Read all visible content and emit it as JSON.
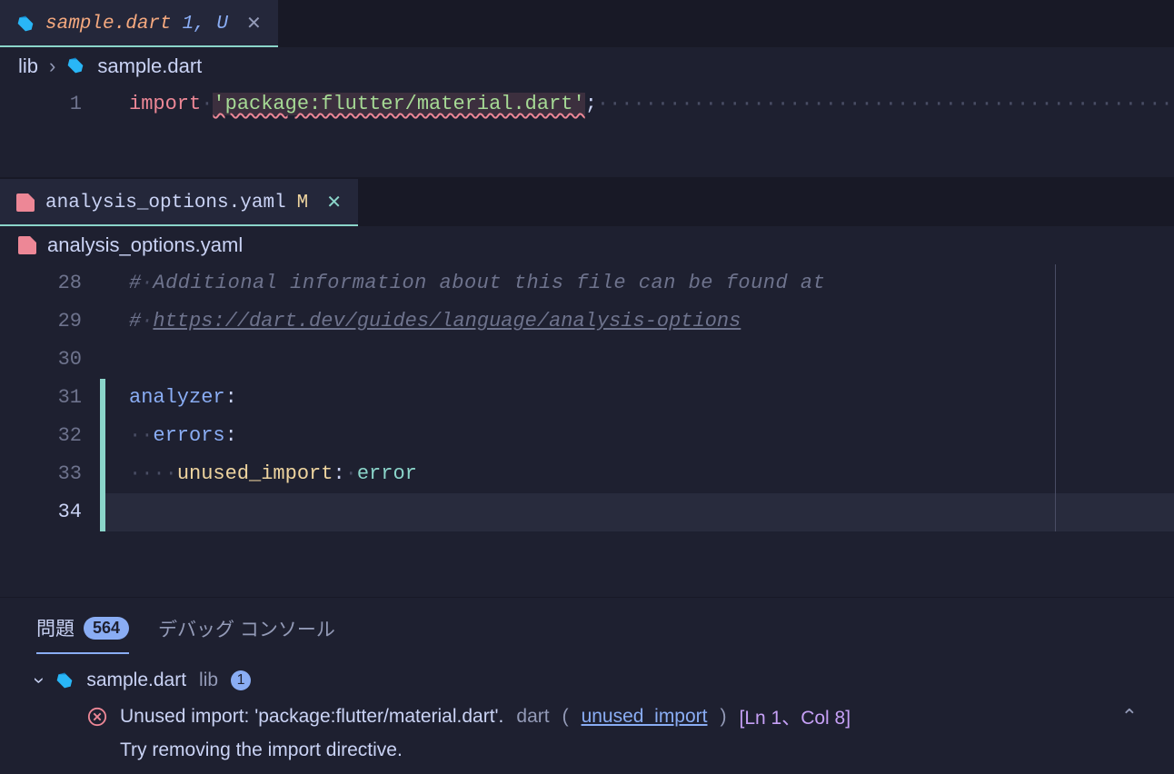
{
  "top": {
    "tab": {
      "filename": "sample.dart",
      "status": "1, U"
    },
    "breadcrumb": {
      "folder": "lib",
      "file": "sample.dart"
    },
    "line": {
      "num": "1",
      "importKw": "import",
      "str": "'package:flutter/material.dart'",
      "semi": ";"
    }
  },
  "mid": {
    "tab": {
      "filename": "analysis_options.yaml",
      "status": "M"
    },
    "breadcrumb": {
      "file": "analysis_options.yaml"
    },
    "lines": {
      "n28": "28",
      "c28a": "#",
      "c28b": "Additional information about this file can be found at",
      "n29": "29",
      "c29a": "#",
      "c29b": "https://dart.dev/guides/language/analysis-options",
      "n30": "30",
      "n31": "31",
      "k31": "analyzer",
      "colon": ":",
      "n32": "32",
      "k32": "errors",
      "n33": "33",
      "k33": "unused_import",
      "v33": "error",
      "n34": "34"
    }
  },
  "bottom": {
    "tabs": {
      "problems": "問題",
      "count": "564",
      "debug": "デバッグ コンソール"
    },
    "file": {
      "name": "sample.dart",
      "folder": "lib",
      "count": "1"
    },
    "problem": {
      "msg": "Unused import: 'package:flutter/material.dart'.",
      "source": "dart",
      "code": "unused_import",
      "loc": "[Ln 1、Col 8]",
      "hint": "Try removing the import directive."
    }
  }
}
